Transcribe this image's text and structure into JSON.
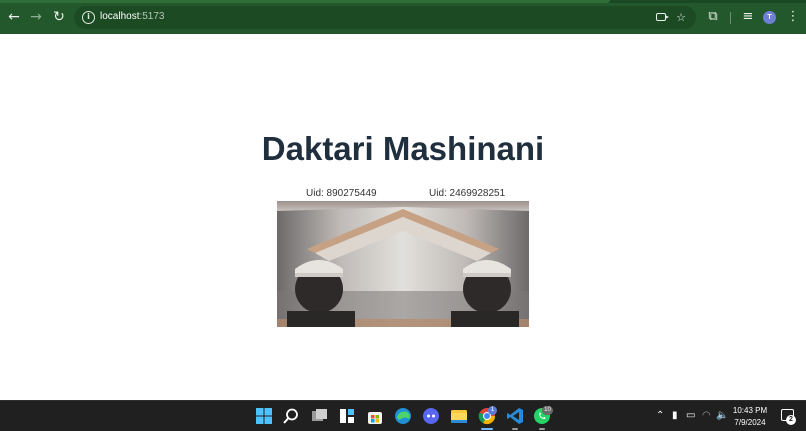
{
  "browser": {
    "url_host": "localhost",
    "url_port": ":5173",
    "profile_initial": "T"
  },
  "page": {
    "title": "Daktari Mashinani",
    "uid_local": "Uid: 890275449",
    "uid_remote": "Uid: 2469928251"
  },
  "taskbar": {
    "apps": [
      "start-icon",
      "search-icon",
      "task-view-icon",
      "widgets-icon",
      "microsoft-store-icon",
      "edge-icon",
      "discord-icon",
      "file-explorer-icon",
      "chrome-icon",
      "vscode-icon",
      "whatsapp-icon"
    ],
    "chrome_badge": "1",
    "whatsapp_badge": "10",
    "time": "10:43 PM",
    "date": "7/9/2024",
    "notification_count": "2"
  }
}
